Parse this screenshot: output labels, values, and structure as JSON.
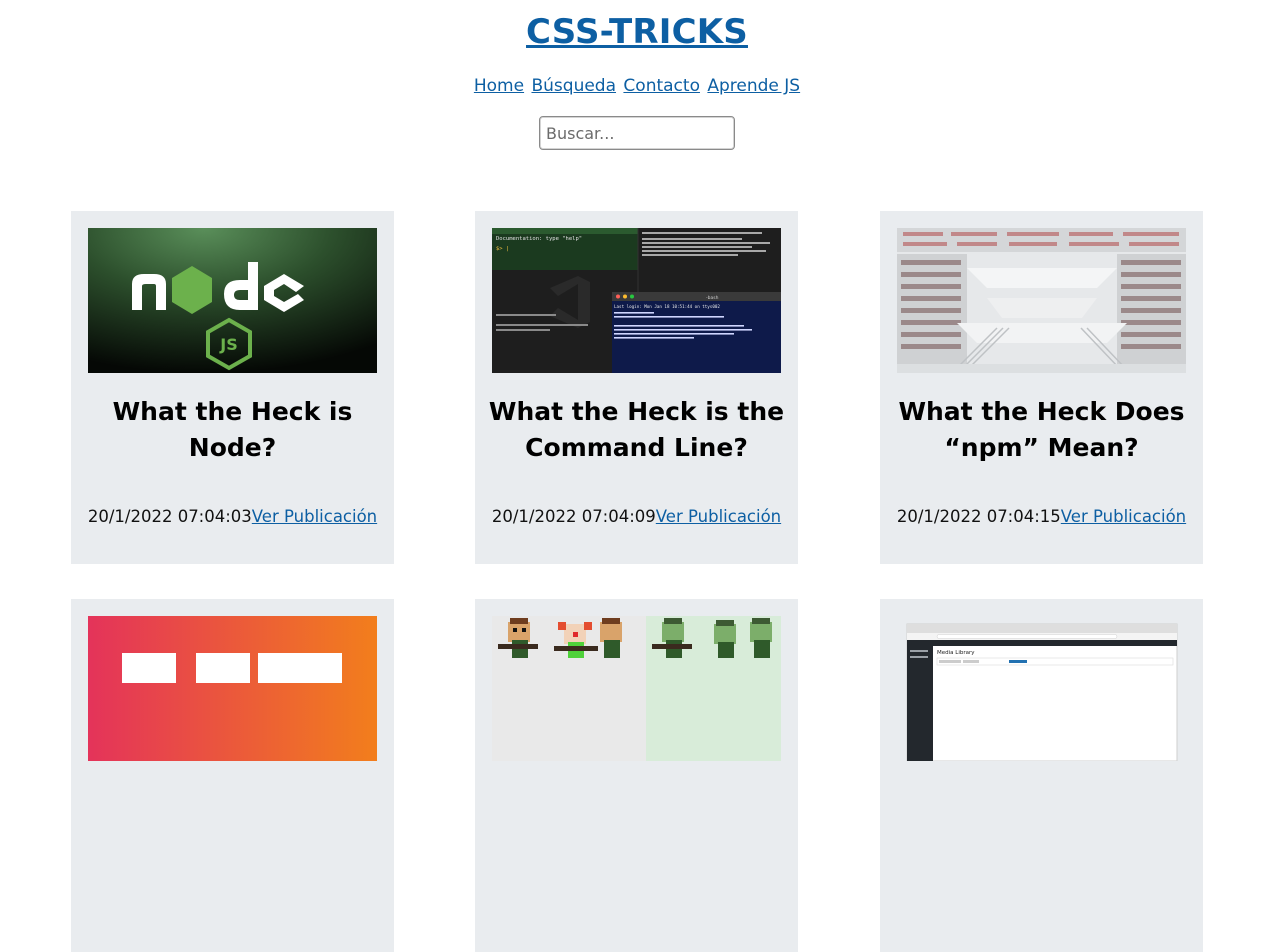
{
  "site": {
    "title": "CSS-TRICKS",
    "accent_color": "#0d5fa3"
  },
  "nav": {
    "items": [
      {
        "label": "Home"
      },
      {
        "label": "Búsqueda"
      },
      {
        "label": "Contacto"
      },
      {
        "label": "Aprende JS"
      }
    ]
  },
  "search": {
    "placeholder": "Buscar...",
    "value": ""
  },
  "posts": [
    {
      "title": "What the Heck is Node?",
      "date": "20/1/2022 07:04:03",
      "link_label": "Ver Publicación",
      "image": "node-js-logo-image"
    },
    {
      "title": "What the Heck is the Command Line?",
      "date": "20/1/2022 07:04:09",
      "link_label": "Ver Publicación",
      "image": "terminal-screenshot-image",
      "image_texts": {
        "doc_line": "Documentation: type \"help\"",
        "window_title": "-bash",
        "login_line": "Last login: Mon Jan 18 10:51:44 on ttys002"
      }
    },
    {
      "title": "What the Heck Does “npm” Mean?",
      "date": "20/1/2022 07:04:15",
      "link_label": "Ver Publicación",
      "image": "library-interior-photo"
    },
    {
      "title": "",
      "date": "",
      "link_label": "",
      "image": "orange-gradient-image"
    },
    {
      "title": "",
      "date": "",
      "link_label": "",
      "image": "pixel-art-characters-image"
    },
    {
      "title": "",
      "date": "",
      "link_label": "",
      "image": "wordpress-media-library-screenshot",
      "image_texts": {
        "heading": "Media Library"
      }
    }
  ]
}
